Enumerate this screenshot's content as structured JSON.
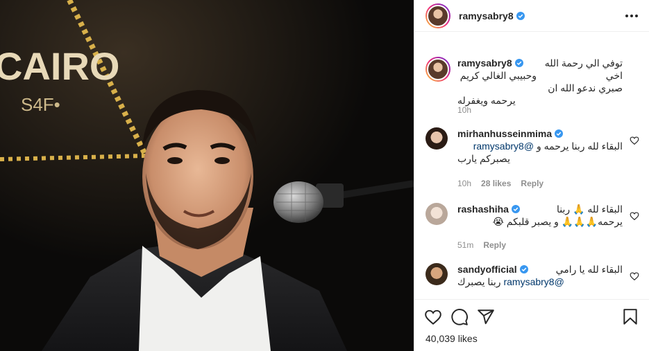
{
  "post": {
    "author": "ramysabry8",
    "photo_sign_text": "CAIRO",
    "photo_sign_sub": "S4F•",
    "caption": {
      "username": "ramysabry8",
      "line1": "توفي الي رحمة الله اخي",
      "line2": "وحبيبي الغالي كريم صبري ندعو الله ان",
      "line3": "يرحمه ويغفرله",
      "time": "10h"
    },
    "comments": [
      {
        "username": "mirhanhusseinmima",
        "mention": "@ramysabry8",
        "line1": "البقاء لله ربنا يرحمه و",
        "line2": "يصبركم يارب",
        "time": "10h",
        "likes": "28 likes",
        "reply": "Reply"
      },
      {
        "username": "rashashiha",
        "line1": "البقاء لله 🙏 ربنا",
        "line2": "يرحمه🙏🙏🙏 و يصبر قلبكم 😭",
        "time": "51m",
        "reply": "Reply"
      },
      {
        "username": "sandyofficial",
        "line1": "البقاء لله يا رامي",
        "mention": "@ramysabry8",
        "line2": "ربنا يصبرك"
      }
    ],
    "likes_count": "40,039 likes"
  },
  "icons": {
    "verified": "verified-badge-icon",
    "more": "more-options-icon",
    "heart": "heart-icon",
    "comment": "comment-icon",
    "share": "share-icon",
    "save": "bookmark-icon"
  },
  "colors": {
    "verified": "#3897f0",
    "text": "#262626",
    "muted": "#8e8e8e",
    "mention": "#00376b",
    "border": "#efefef"
  }
}
